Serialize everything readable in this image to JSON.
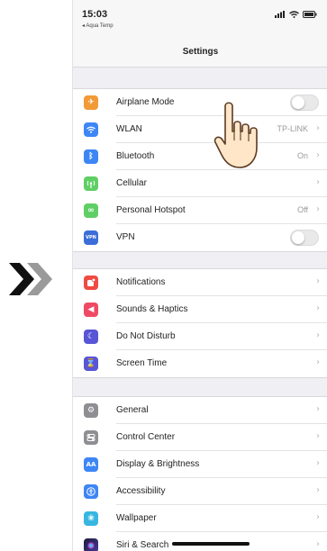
{
  "status": {
    "time": "15:03",
    "back_app": "Aqua Temp"
  },
  "nav": {
    "title": "Settings"
  },
  "groups": [
    {
      "rows": [
        {
          "label": "Airplane Mode",
          "icon": "airplane-icon",
          "color": "#f19a37",
          "accessory": "toggle",
          "toggle_on": false
        },
        {
          "label": "WLAN",
          "icon": "wifi-icon",
          "color": "#3d86f5",
          "value": "TP-LINK",
          "accessory": "chevron"
        },
        {
          "label": "Bluetooth",
          "icon": "bluetooth-icon",
          "color": "#3d86f5",
          "value": "On",
          "accessory": "chevron"
        },
        {
          "label": "Cellular",
          "icon": "cellular-icon",
          "color": "#5fcf65",
          "accessory": "chevron"
        },
        {
          "label": "Personal Hotspot",
          "icon": "hotspot-icon",
          "color": "#5fcf65",
          "value": "Off",
          "accessory": "chevron"
        },
        {
          "label": "VPN",
          "icon": "vpn-icon",
          "color": "#3c6ed9",
          "icon_text": "VPN",
          "accessory": "toggle",
          "toggle_on": false
        }
      ]
    },
    {
      "rows": [
        {
          "label": "Notifications",
          "icon": "notifications-icon",
          "color": "#ef4b42",
          "accessory": "chevron"
        },
        {
          "label": "Sounds & Haptics",
          "icon": "sounds-icon",
          "color": "#ef4a64",
          "accessory": "chevron"
        },
        {
          "label": "Do Not Disturb",
          "icon": "moon-icon",
          "color": "#5856d6",
          "accessory": "chevron"
        },
        {
          "label": "Screen Time",
          "icon": "hourglass-icon",
          "color": "#5856d6",
          "accessory": "chevron"
        }
      ]
    },
    {
      "rows": [
        {
          "label": "General",
          "icon": "gear-icon",
          "color": "#8e8e93",
          "accessory": "chevron"
        },
        {
          "label": "Control Center",
          "icon": "switches-icon",
          "color": "#8e8e93",
          "accessory": "chevron"
        },
        {
          "label": "Display & Brightness",
          "icon": "display-icon",
          "color": "#3d86f5",
          "icon_text": "AA",
          "accessory": "chevron"
        },
        {
          "label": "Accessibility",
          "icon": "accessibility-icon",
          "color": "#3d86f5",
          "accessory": "chevron"
        },
        {
          "label": "Wallpaper",
          "icon": "wallpaper-icon",
          "color": "#37b6e0",
          "accessory": "chevron"
        },
        {
          "label": "Siri & Search",
          "icon": "siri-icon",
          "color": "#2a2a5e",
          "accessory": "chevron"
        }
      ]
    }
  ]
}
